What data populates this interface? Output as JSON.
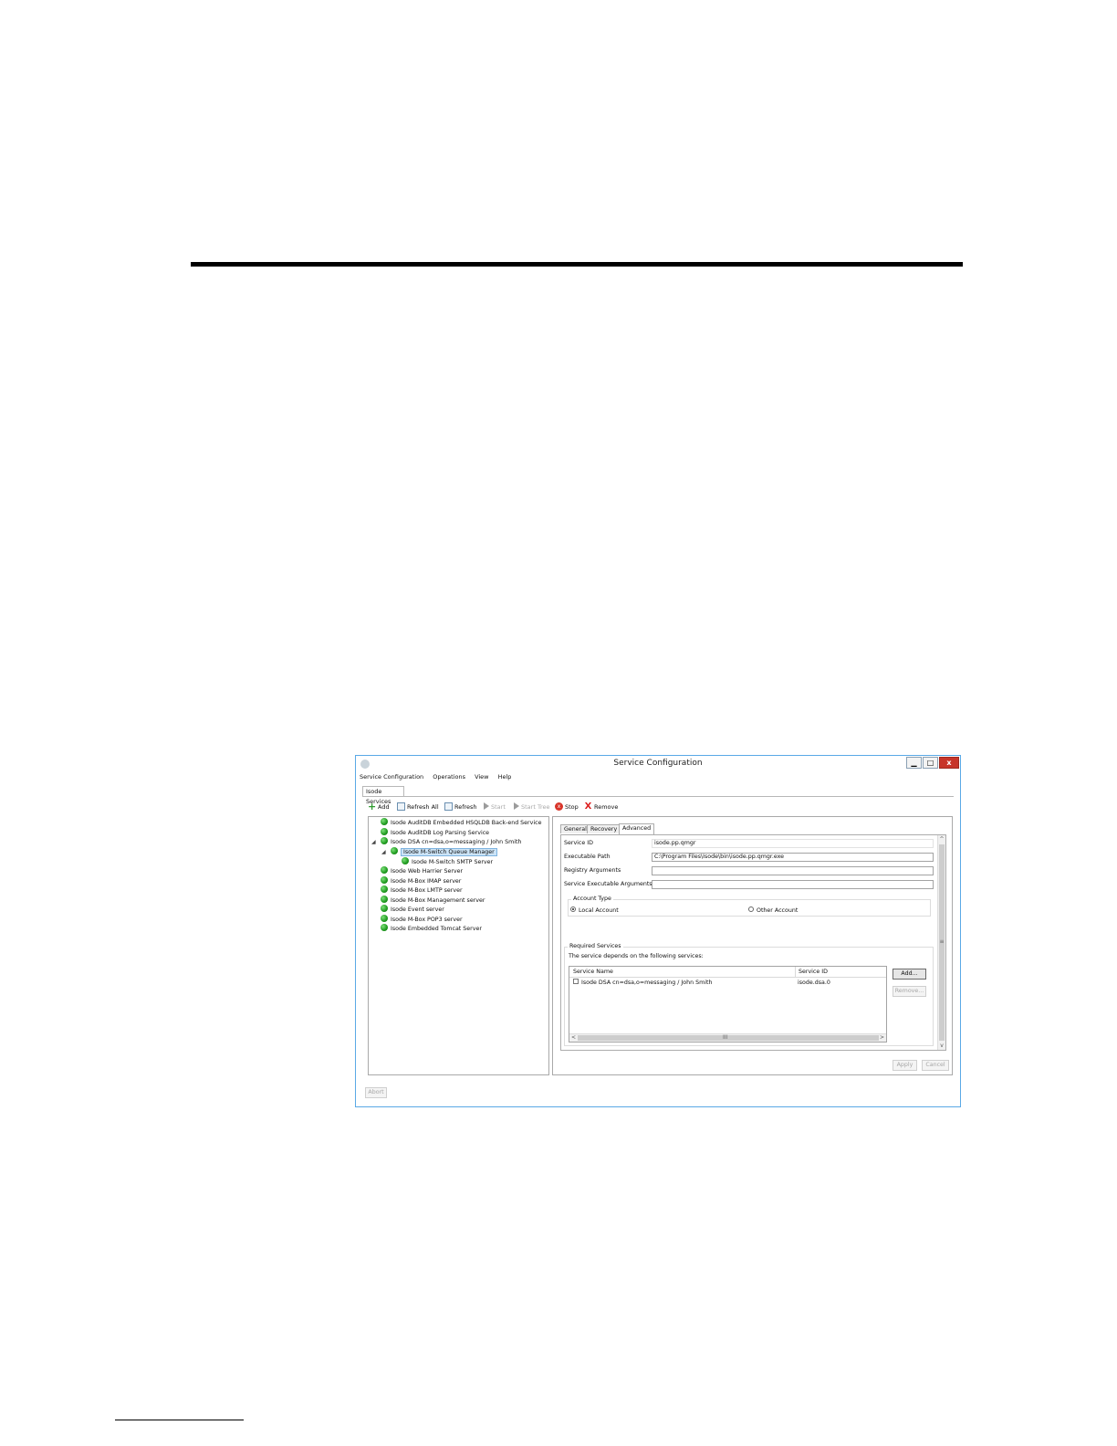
{
  "window": {
    "title": "Service Configuration",
    "min": "▁",
    "max": "□",
    "close": "x"
  },
  "menu": [
    "Service Configuration",
    "Operations",
    "View",
    "Help"
  ],
  "doc_tab": "Isode Services",
  "toolbar": {
    "add": "Add",
    "refresh_all": "Refresh All",
    "refresh": "Refresh",
    "start": "Start",
    "start_tree": "Start Tree",
    "stop": "Stop",
    "remove": "Remove"
  },
  "services": [
    {
      "label": "Isode AuditDB Embedded HSQLDB Back-end Service"
    },
    {
      "label": "Isode AuditDB Log Parsing Service"
    },
    {
      "label": "Isode DSA cn=dsa,o=messaging / John Smith"
    },
    {
      "label": "Isode M-Switch Queue Manager"
    },
    {
      "label": "Isode M-Switch SMTP Server"
    },
    {
      "label": "Isode Web Harrier Server"
    },
    {
      "label": "Isode M-Box IMAP server"
    },
    {
      "label": "Isode M-Box LMTP server"
    },
    {
      "label": "Isode M-Box Management server"
    },
    {
      "label": "Isode Event server"
    },
    {
      "label": "Isode M-Box POP3 server"
    },
    {
      "label": "Isode Embedded Tomcat Server"
    }
  ],
  "tabs": {
    "general": "General",
    "recovery": "Recovery",
    "advanced": "Advanced"
  },
  "advanced": {
    "service_id_label": "Service ID",
    "service_id_value": "isode.pp.qmgr",
    "exec_path_label": "Executable Path",
    "exec_path_value": "C:\\Program Files\\Isode\\bin\\isode.pp.qmgr.exe",
    "registry_args_label": "Registry Arguments",
    "registry_args_value": "",
    "service_exec_args_label": "Service Executable Arguments",
    "service_exec_args_value": "",
    "account_type_label": "Account Type",
    "local_account": "Local Account",
    "other_account": "Other Account",
    "account_selected": "local"
  },
  "required": {
    "group_label": "Required Services",
    "description": "The service depends on the following services:",
    "col_name": "Service Name",
    "col_id": "Service ID",
    "rows": [
      {
        "name": "Isode DSA cn=dsa,o=messaging / John Smith",
        "id": "isode.dsa.0"
      }
    ],
    "add": "Add...",
    "remove": "Remove..."
  },
  "footer": {
    "apply": "Apply",
    "cancel": "Cancel",
    "abort": "Abort"
  },
  "icons": {
    "scroll_up": "^",
    "scroll_down": "v",
    "scroll_left": "<",
    "scroll_right": ">",
    "grip_v": "≡",
    "grip_h": "III",
    "expand": "◢",
    "stop": "x",
    "add": "+",
    "remove": "X"
  }
}
